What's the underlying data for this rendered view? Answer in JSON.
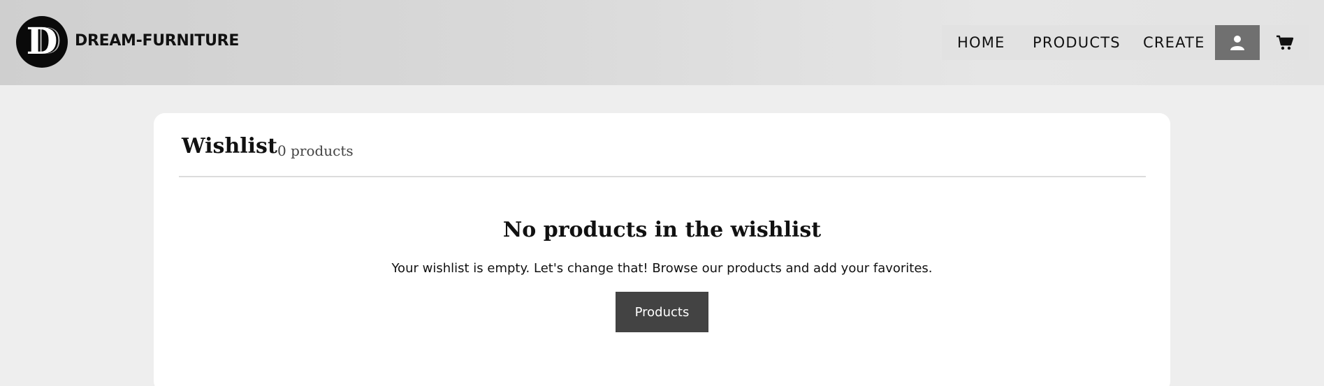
{
  "header": {
    "logo_letter": "D",
    "brand": "DREAM-FURNITURE",
    "nav": {
      "home": "HOME",
      "products": "PRODUCTS",
      "create": "CREATE",
      "user_icon": "user-icon",
      "cart_icon": "cart-icon"
    }
  },
  "wishlist": {
    "title": "Wishlist",
    "count": "0 products",
    "empty_title": "No products in the wishlist",
    "empty_text": "Your wishlist is empty. Let's change that! Browse our products and add your favorites.",
    "button_label": "Products"
  },
  "colors": {
    "page_background": "#eeeeee",
    "card_background": "#ffffff",
    "button_background": "#434343",
    "user_button_background": "#707070",
    "logo_background": "#0a0a0a"
  }
}
